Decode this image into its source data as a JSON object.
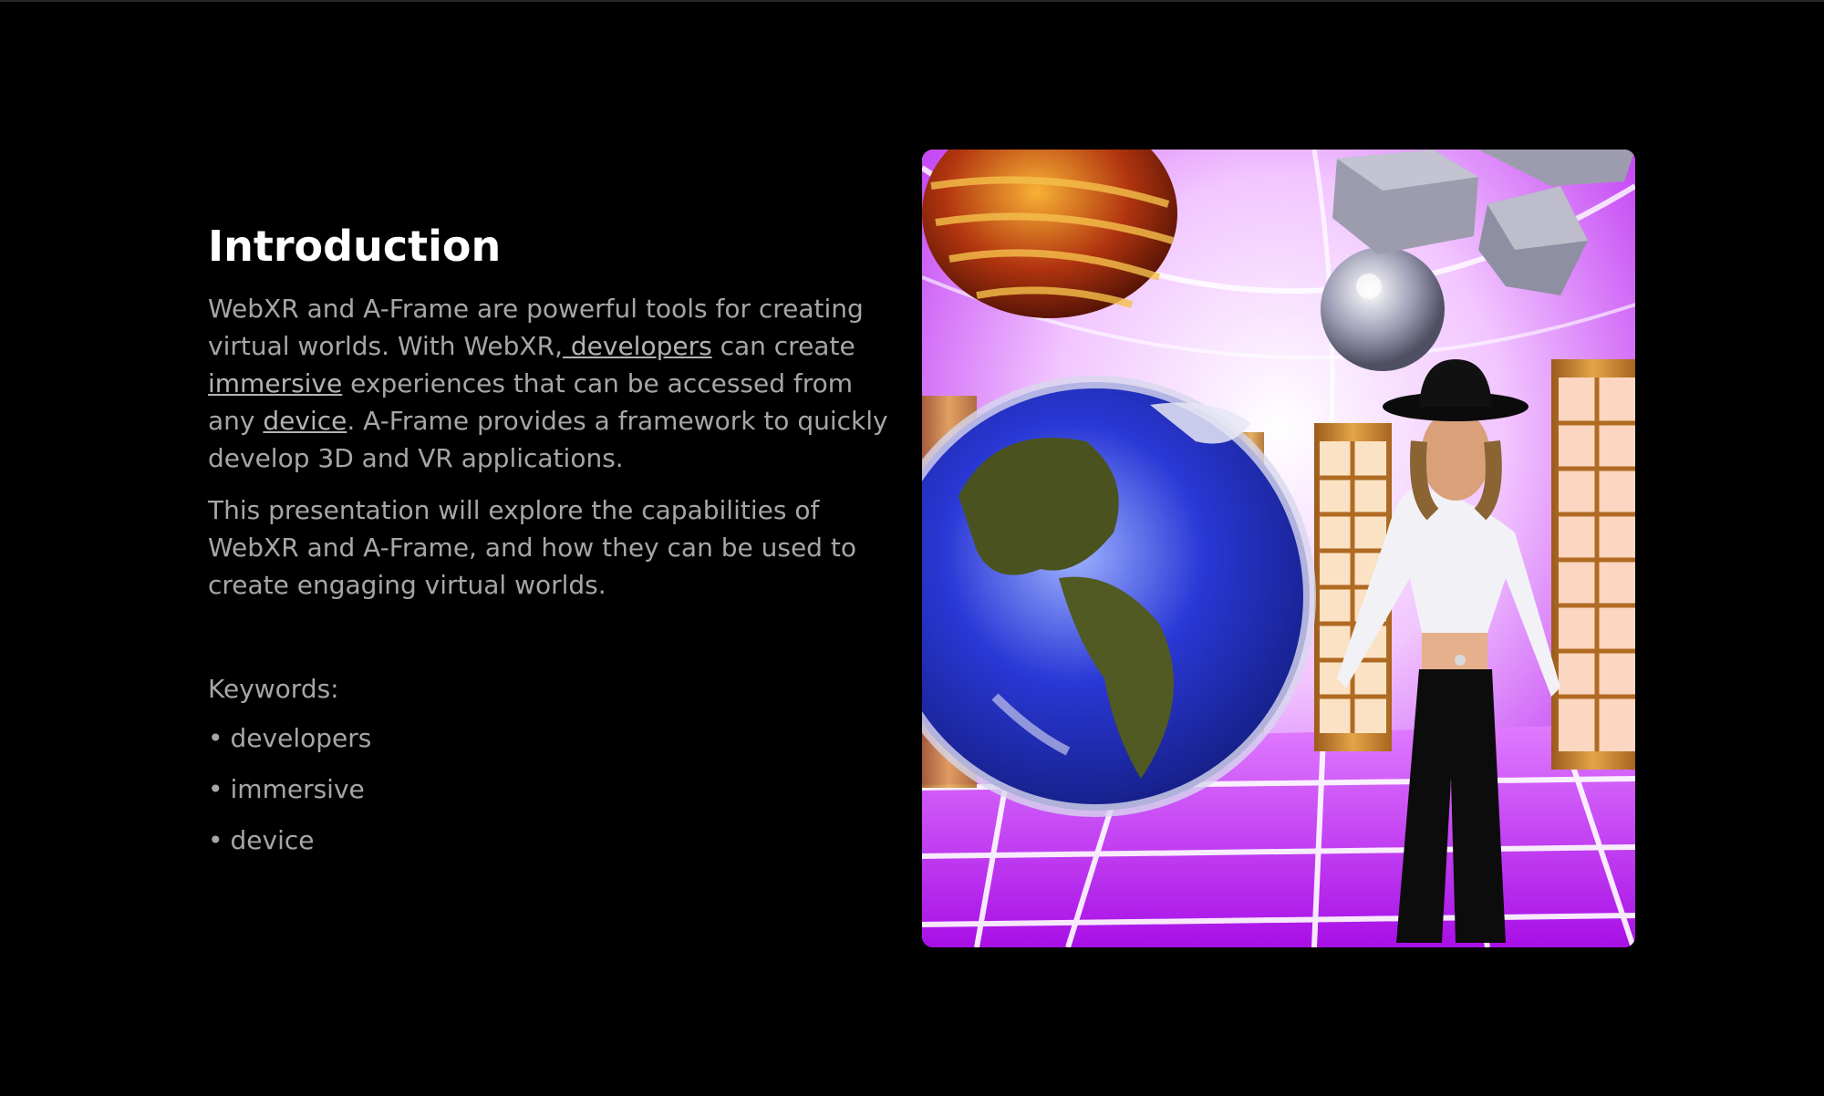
{
  "slide": {
    "title": "Introduction",
    "paragraph1": {
      "part1": "WebXR and A-Frame are powerful tools for creating virtual worlds. With WebXR,",
      "link1": " developers",
      "part2": " can create ",
      "link2": "immersive",
      "part3": " experiences that can be accessed from any ",
      "link3": "device",
      "part4": ". A-Frame provides a framework to quickly develop 3D and VR applications."
    },
    "paragraph2": "This presentation will explore the capabilities of WebXR and A-Frame, and how they can be used to create engaging virtual worlds.",
    "keywords_label": "Keywords:",
    "keywords": [
      "developers",
      "immersive",
      "device"
    ],
    "bullet": "•"
  },
  "image": {
    "subject": "virtual-world-scene",
    "colors": {
      "background": "#000000",
      "floor": "#c020f0",
      "grid": "#ffffff",
      "wood": "#c98a2e",
      "globe_ocean": "#2336c8",
      "globe_land": "#4e5a1e"
    }
  }
}
